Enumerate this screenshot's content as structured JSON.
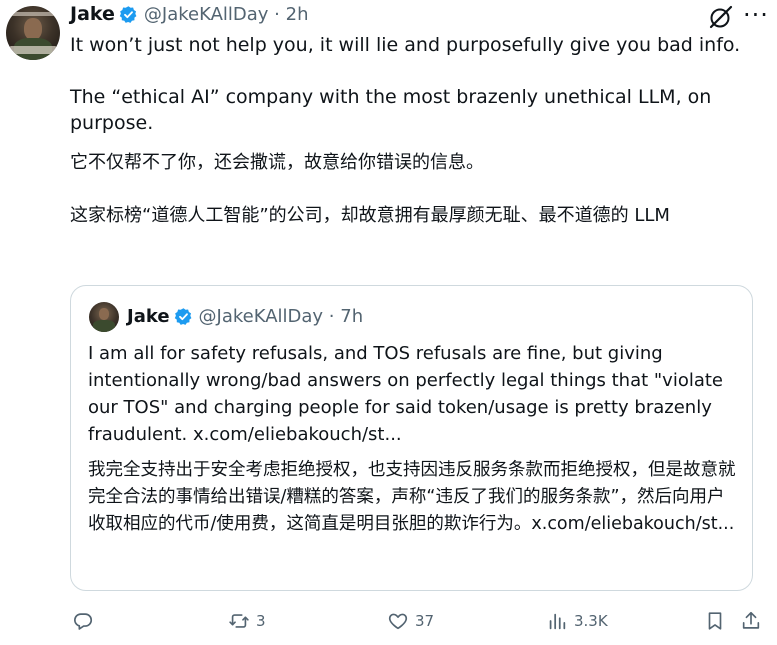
{
  "tweet": {
    "author_name": "Jake",
    "handle_time": "@JakeKAllDay · 2h",
    "paragraph_1": "It won’t just not help you, it will lie and purposefully give you bad info.",
    "paragraph_2": "The “ethical AI” company with the most brazenly unethical LLM, on purpose.",
    "paragraph_3": "它不仅帮不了你，还会撒谎，故意给你错误的信息。",
    "paragraph_4": "这家标榜“道德人工智能”的公司，却故意拥有最厚颜无耻、最不道德的 LLM"
  },
  "quote": {
    "author_name": "Jake",
    "handle_time": "@JakeKAllDay · 7h",
    "text_en": "I am all for safety refusals, and TOS refusals are fine, but giving intentionally wrong/bad answers on perfectly legal things that \"violate our TOS\" and charging people for said token/usage is pretty brazenly fraudulent. x.com/eliebakouch/st...",
    "text_zh": "我完全支持出于安全考虑拒绝授权，也支持因违反服务条款而拒绝授权，但是故意就完全合法的事情给出错误/糟糕的答案，声称“违反了我们的服务条款”，然后向用户收取相应的代币/使用费，这简直是明目张胆的欺诈行为。x.com/eliebakouch/st..."
  },
  "actions": {
    "reply_count": "",
    "repost_count": "3",
    "like_count": "37",
    "views_count": "3.3K"
  },
  "icons": {
    "verified": "verified-badge-icon",
    "grok": "grok-icon",
    "more": "more-icon",
    "reply": "reply-icon",
    "repost": "repost-icon",
    "like": "heart-icon",
    "views": "views-icon",
    "bookmark": "bookmark-icon",
    "share": "share-icon"
  },
  "colors": {
    "verified_blue": "#1d9bf0",
    "text": "#0f1419",
    "muted": "#536471",
    "border": "#cfd9de"
  }
}
